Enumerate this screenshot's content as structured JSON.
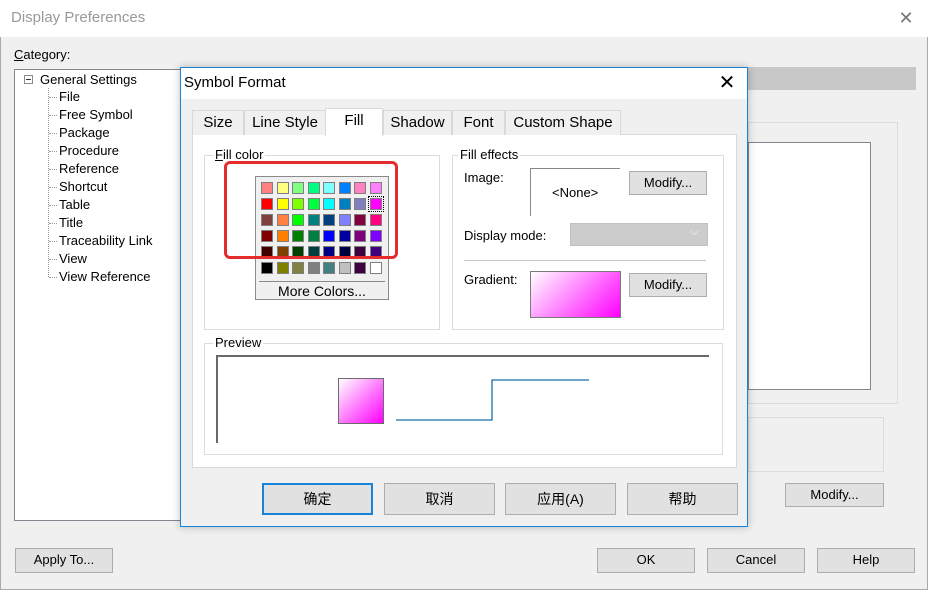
{
  "background_dialog": {
    "title": "Display Preferences",
    "category_label": "Category:",
    "tree": {
      "root": "General Settings",
      "items": [
        "File",
        "Free Symbol",
        "Package",
        "Procedure",
        "Reference",
        "Shortcut",
        "Table",
        "Title",
        "Traceability Link",
        "View",
        "View Reference"
      ]
    },
    "buttons": {
      "apply_to": "Apply To...",
      "modify": "Modify...",
      "ok": "OK",
      "cancel": "Cancel",
      "help": "Help"
    }
  },
  "symbol_format": {
    "title": "Symbol Format",
    "tabs": [
      "Size",
      "Line Style",
      "Fill",
      "Shadow",
      "Font",
      "Custom Shape"
    ],
    "active_tab": "Fill",
    "fill_color": {
      "label": "Fill color",
      "more_colors": "More Colors...",
      "selected": "#ff00ff",
      "palette": [
        [
          "#ff8080",
          "#ffff80",
          "#80ff80",
          "#00ff80",
          "#80ffff",
          "#0080ff",
          "#ff80c0",
          "#ff80ff"
        ],
        [
          "#ff0000",
          "#ffff00",
          "#80ff00",
          "#00ff40",
          "#00ffff",
          "#0080c0",
          "#8080c0",
          "#ff00ff"
        ],
        [
          "#804040",
          "#ff8040",
          "#00ff00",
          "#008080",
          "#004080",
          "#8080ff",
          "#800040",
          "#ff0080"
        ],
        [
          "#800000",
          "#ff8000",
          "#008000",
          "#008040",
          "#0000ff",
          "#0000a0",
          "#800080",
          "#8000ff"
        ],
        [
          "#400000",
          "#804000",
          "#004000",
          "#004040",
          "#000080",
          "#000040",
          "#400040",
          "#400080"
        ],
        [
          "#000000",
          "#808000",
          "#808040",
          "#808080",
          "#408080",
          "#c0c0c0",
          "#400040",
          "#ffffff"
        ]
      ]
    },
    "fill_effects": {
      "label": "Fill effects",
      "image_label": "Image:",
      "image_value": "<None>",
      "modify_label": "Modify...",
      "display_mode_label": "Display mode:",
      "gradient_label": "Gradient:"
    },
    "preview": {
      "label": "Preview"
    },
    "buttons": {
      "ok": "确定",
      "cancel": "取消",
      "apply": "应用(A)",
      "help": "帮助"
    }
  }
}
